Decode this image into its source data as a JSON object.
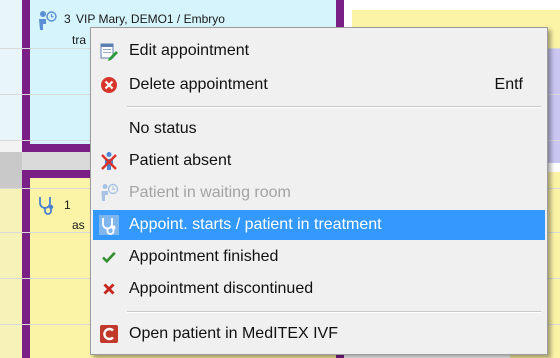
{
  "calendar": {
    "appointments": [
      {
        "prefix": "3",
        "title": "VIP  Mary, DEMO1 / Embryo",
        "line2": "tra"
      },
      {
        "prefix": "1",
        "title": "",
        "line2": "as"
      }
    ],
    "right_partial_text": "/"
  },
  "menu": {
    "items": [
      {
        "label": "Edit appointment",
        "icon": "edit-appointment-icon",
        "shortcut": "",
        "state": "normal"
      },
      {
        "label": "Delete appointment",
        "icon": "delete-icon",
        "shortcut": "Entf",
        "state": "normal"
      },
      {
        "label": "No status",
        "icon": "",
        "shortcut": "",
        "state": "normal"
      },
      {
        "label": "Patient absent",
        "icon": "patient-absent-icon",
        "shortcut": "",
        "state": "normal"
      },
      {
        "label": "Patient in waiting room",
        "icon": "waiting-room-icon",
        "shortcut": "",
        "state": "disabled"
      },
      {
        "label": "Appoint. starts / patient in treatment",
        "icon": "stethoscope-icon",
        "shortcut": "",
        "state": "highlighted"
      },
      {
        "label": "Appointment finished",
        "icon": "check-icon",
        "shortcut": "",
        "state": "normal"
      },
      {
        "label": "Appointment discontinued",
        "icon": "x-mark-icon",
        "shortcut": "",
        "state": "normal"
      },
      {
        "label": "Open patient in MedITEX IVF",
        "icon": "meditex-icon",
        "shortcut": "",
        "state": "normal"
      }
    ]
  },
  "colors": {
    "highlight": "#3399ff",
    "appointment_purple": "#7a1f86",
    "appointment_light_blue": "#d6f4fb",
    "appointment_yellow": "#fbf3a6",
    "appointment_lavender": "#c9c6f2"
  }
}
